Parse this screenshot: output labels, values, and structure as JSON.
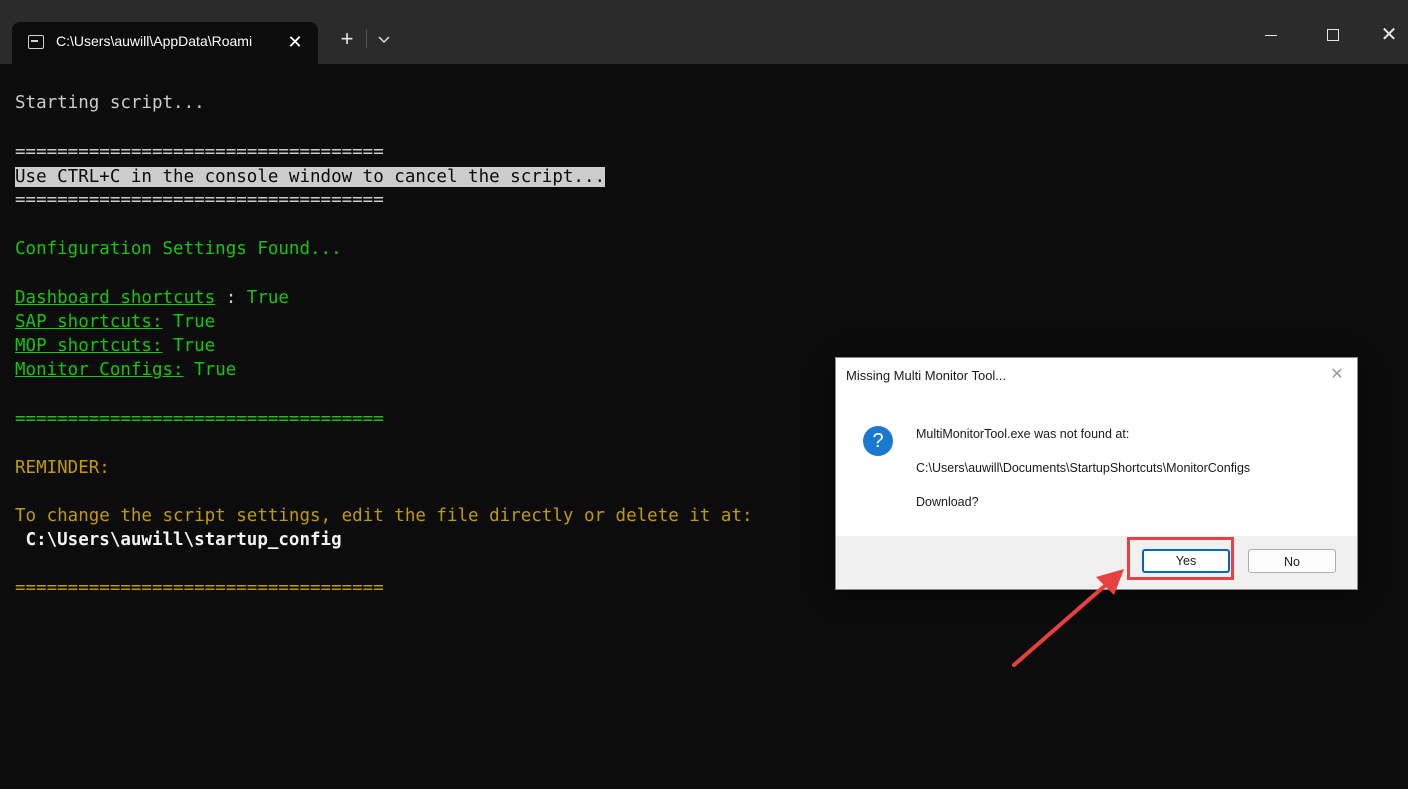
{
  "window": {
    "tab_title": "C:\\Users\\auwill\\AppData\\Roami",
    "tab_close": "✕",
    "new_tab": "+",
    "close_glyph": "✕"
  },
  "console": {
    "line_starting": "Starting script...",
    "separator": "===================================",
    "cancel_hint": "Use CTRL+C in the console window to cancel the script...",
    "config_found": "Configuration Settings Found...",
    "settings": [
      {
        "label": "Dashboard shortcuts",
        "sep": " : ",
        "value": "True"
      },
      {
        "label": "SAP shortcuts:",
        "sep": " ",
        "value": "True"
      },
      {
        "label": "MOP shortcuts:",
        "sep": " ",
        "value": "True"
      },
      {
        "label": "Monitor Configs:",
        "sep": " ",
        "value": "True"
      }
    ],
    "reminder": "REMINDER:",
    "change_settings": "To change the script settings, edit the file directly or delete it at:",
    "config_path": " C:\\Users\\auwill\\startup_config"
  },
  "dialog": {
    "title": "Missing Multi Monitor Tool...",
    "close_glyph": "✕",
    "icon_glyph": "?",
    "message_line1": "MultiMonitorTool.exe was not found at:",
    "message_line2": "C:\\Users\\auwill\\Documents\\StartupShortcuts\\MonitorConfigs",
    "message_line3": "Download?",
    "yes_label": "Yes",
    "no_label": "No"
  },
  "colors": {
    "console_bg": "#0c0c0c",
    "green": "#16c60c",
    "yellow": "#c19c00",
    "callout_red": "#e84040",
    "accent_blue": "#0067c0"
  }
}
